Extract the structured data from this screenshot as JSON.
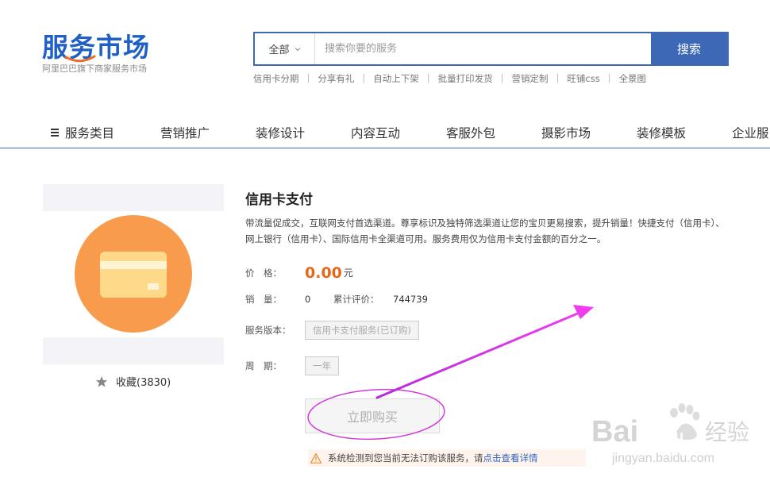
{
  "header": {
    "logo_text": "服务市场",
    "logo_subtitle": "阿里巴巴旗下商家服务市场",
    "search": {
      "category": "全部",
      "placeholder": "搜索你要的服务",
      "button_label": "搜索"
    },
    "hot_links": [
      "信用卡分期",
      "分享有礼",
      "自动上下架",
      "批量打印发货",
      "营销定制",
      "旺铺css",
      "全景图"
    ]
  },
  "nav": {
    "items": [
      "服务类目",
      "营销推广",
      "装修设计",
      "内容互动",
      "客服外包",
      "摄影市场",
      "装修模板",
      "企业服"
    ]
  },
  "product": {
    "favorite_label": "收藏(3830)",
    "title": "信用卡支付",
    "description": "带流量促成交，互联网支付首选渠道。尊享标识及独特筛选渠道让您的宝贝更易搜索，提升销量！快捷支付（信用卡）、网上银行（信用卡）、国际信用卡全渠道可用。服务费用仅为信用卡支付金额的百分之一。",
    "price_label": "价　格：",
    "price": "0.00",
    "price_unit": "元",
    "sales_label": "销　量：",
    "sales": "0",
    "rating_label": "累计评价：",
    "rating": "744739",
    "version_label": "服务版本：",
    "version_option": "信用卡支付服务(已订购)",
    "cycle_label": "周　期：",
    "cycle_option": "一年",
    "buy_button": "立即购买",
    "warning_text": "系统检测到您当前无法订购该服务，请",
    "warning_link": "点击查看详情"
  },
  "watermark": {
    "brand": "Bai",
    "brand2": "du",
    "cn": "经验",
    "url": "jingyan.baidu.com"
  },
  "colors": {
    "brand_blue": "#3c68b5",
    "icon_orange": "#f99b4c",
    "card_yellow": "#ffd98a",
    "price_orange": "#e4691b",
    "annotation_magenta": "#e13ce4"
  }
}
